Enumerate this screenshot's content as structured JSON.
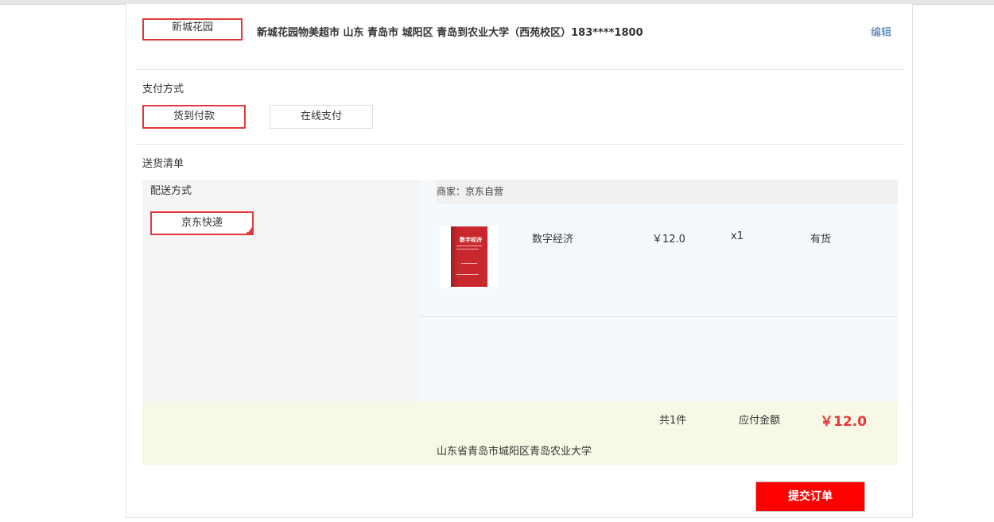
{
  "address": {
    "tag": "新城花园",
    "detail": "新城花园物美超市 山东 青岛市 城阳区 青岛到农业大学（西苑校区）183****1800",
    "edit_label": "编辑"
  },
  "payment": {
    "title": "支付方式",
    "options": [
      "货到付款",
      "在线支付"
    ],
    "selected": "货到付款"
  },
  "delivery_list": {
    "title": "送货清单",
    "method_title": "配送方式",
    "method": "京东快递",
    "merchant": "商家：京东自营",
    "items": [
      {
        "name": "数字经济",
        "price": "￥12.0",
        "quantity": "x1",
        "stock": "有货",
        "cover_title": "数字经济"
      }
    ]
  },
  "summary": {
    "count": "共1件",
    "amount_label": "应付金额",
    "amount": "￥12.0",
    "ship_address": "山东省青岛市城阳区青岛农业大学"
  },
  "submit_label": "提交订单",
  "colors": {
    "accent": "#e4393c",
    "submit_bg": "#ff0000",
    "link": "#3a6ea5"
  }
}
